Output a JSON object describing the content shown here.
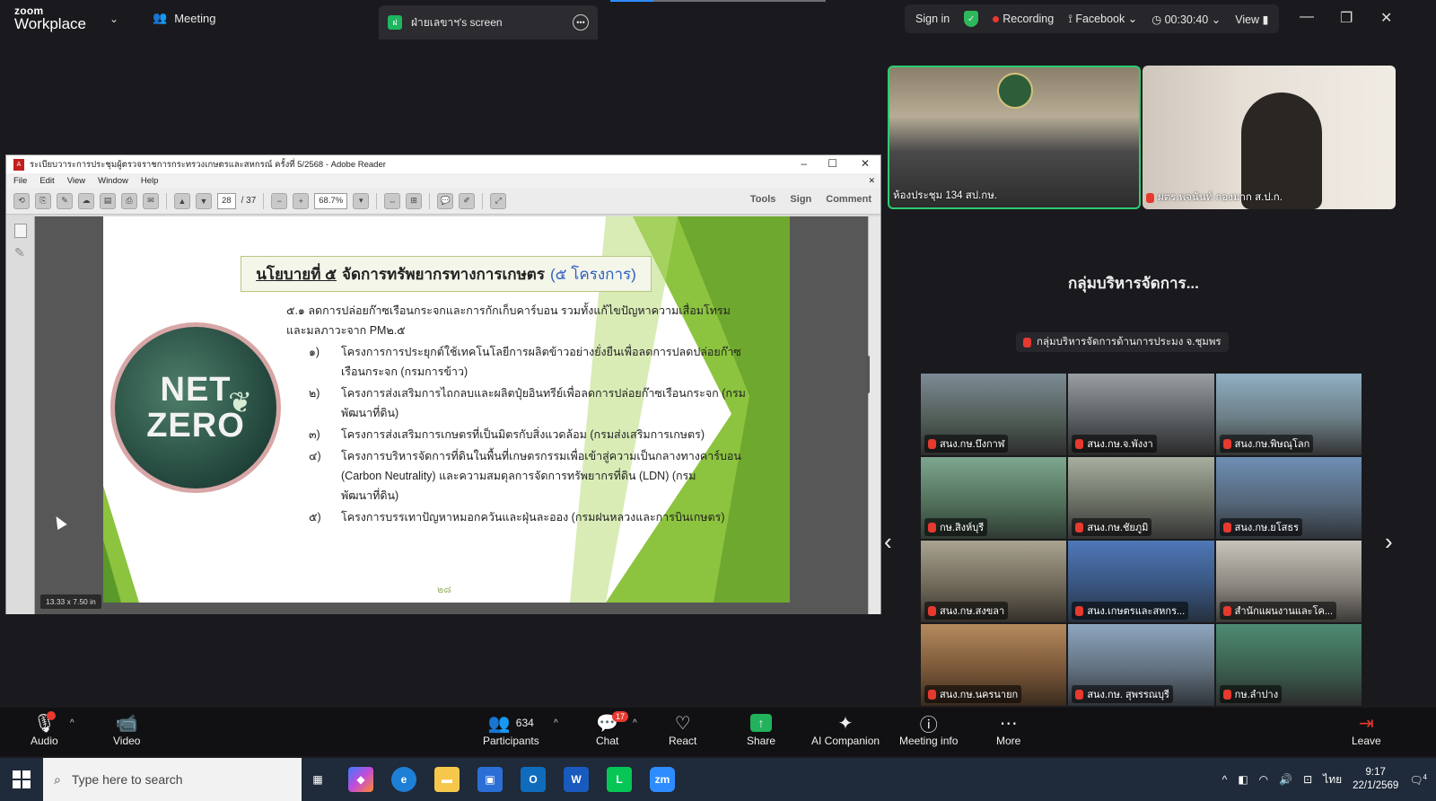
{
  "app": {
    "brand_top": "zoom",
    "brand_bottom": "Workplace",
    "meeting_label": "Meeting",
    "screen_tab_label": "ฝ่ายเลขาฯ's screen",
    "screen_tab_badge": "ฝ"
  },
  "status_bar": {
    "sign_in": "Sign in",
    "recording": "Recording",
    "facebook": "Facebook",
    "timer": "00:30:40",
    "view": "View"
  },
  "reader": {
    "title": "ระเบียบวาระการประชุมผู้ตรวจราชการกระทรวงเกษตรและสหกรณ์ ครั้งที่ 5/2568 - Adobe Reader",
    "menu": [
      "File",
      "Edit",
      "View",
      "Window",
      "Help"
    ],
    "page_current": "28",
    "page_total": "/ 37",
    "zoom": "68.7%",
    "tools": "Tools",
    "sign": "Sign",
    "comment": "Comment",
    "size_badge": "13.33 x 7.50 in"
  },
  "slide": {
    "title_underlined": "นโยบายที่ ๕",
    "title_main": "จัดการทรัพยากรทางการเกษตร",
    "title_blue": "(๕ โครงการ)",
    "intro": "๕.๑ ลดการปล่อยก๊าซเรือนกระจกและการกักเก็บคาร์บอน รวมทั้งแก้ไขปัญหาความเสื่อมโทรมและมลภาวะจาก PM๒.๕",
    "items": [
      {
        "num": "๑)",
        "text": "โครงการการประยุกต์ใช้เทคโนโลยีการผลิตข้าวอย่างยั่งยืนเพื่อลดการปลดปล่อยก๊าซเรือนกระจก (กรมการข้าว)"
      },
      {
        "num": "๒)",
        "text": "โครงการส่งเสริมการไถกลบและผลิตปุ๋ยอินทรีย์เพื่อลดการปล่อยก๊าซเรือนกระจก (กรมพัฒนาที่ดิน)"
      },
      {
        "num": "๓)",
        "text": "โครงการส่งเสริมการเกษตรที่เป็นมิตรกับสิ่งแวดล้อม (กรมส่งเสริมการเกษตร)"
      },
      {
        "num": "๔)",
        "text": "โครงการบริหารจัดการที่ดินในพื้นที่เกษตรกรรมเพื่อเข้าสู่ความเป็นกลางทางคาร์บอน (Carbon Neutrality) และความสมดุลการจัดการทรัพยากรที่ดิน (LDN) (กรมพัฒนาที่ดิน)"
      },
      {
        "num": "๕)",
        "text": "โครงการบรรเทาปัญหาหมอกควันและฝุ่นละออง (กรมฝนหลวงและการบินเกษตร)"
      }
    ],
    "logo_line1": "NET",
    "logo_line2": "ZERO",
    "page_number": "๒๘"
  },
  "participants_panel": {
    "tile1_label": "ห้องประชุม 134 สป.กษ.",
    "tile2_label": "ผตร.พจนันท์ กองมาก ส.ป.ก.",
    "group_title": "กลุ่มบริหารจัดการ...",
    "group_sub": "กลุ่มบริหารจัดการด้านการประมง จ.ชุมพร",
    "grid": [
      "สนง.กษ.บึงกาฬ",
      "สนง.กษ.จ.พังงา",
      "สนง.กษ.พิษณุโลก",
      "กษ.สิงห์บุรี",
      "สนง.กษ.ชัยภูมิ",
      "สนง.กษ.ยโสธร",
      "สนง.กษ.สงขลา",
      "สนง.เกษตรและสหกร...",
      "สำนักแผนงานและโค...",
      "สนง.กษ.นครนายก",
      "สนง.กษ. สุพรรณบุรี",
      "กษ.ลำปาง"
    ]
  },
  "controls": {
    "audio": "Audio",
    "video": "Video",
    "participants": "Participants",
    "participants_count": "634",
    "chat": "Chat",
    "chat_badge": "17",
    "react": "React",
    "share": "Share",
    "ai_companion": "AI Companion",
    "meeting_info": "Meeting info",
    "more": "More",
    "leave": "Leave"
  },
  "taskbar": {
    "search_placeholder": "Type here to search",
    "lang": "ไทย",
    "time": "9:17",
    "date": "22/1/2569",
    "notif_count": "4",
    "zoom_app": "zm"
  }
}
